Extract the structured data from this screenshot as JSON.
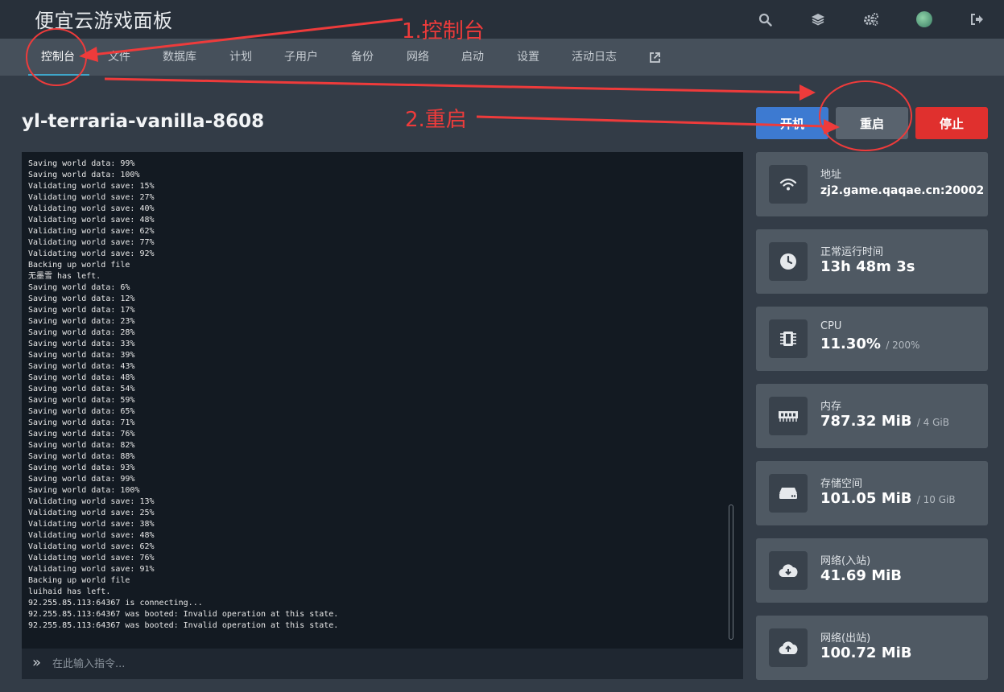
{
  "app": {
    "title": "便宜云游戏面板"
  },
  "top_icons": [
    "search-icon",
    "layers-icon",
    "gear-icon",
    "avatar",
    "logout-icon"
  ],
  "tabs": [
    {
      "label": "控制台",
      "active": true
    },
    {
      "label": "文件"
    },
    {
      "label": "数据库"
    },
    {
      "label": "计划"
    },
    {
      "label": "子用户"
    },
    {
      "label": "备份"
    },
    {
      "label": "网络"
    },
    {
      "label": "启动"
    },
    {
      "label": "设置"
    },
    {
      "label": "活动日志"
    }
  ],
  "server": {
    "name": "yl-terraria-vanilla-8608"
  },
  "power": {
    "start": "开机",
    "restart": "重启",
    "stop": "停止"
  },
  "console": {
    "lines": [
      "Saving world data: 99%",
      "Saving world data: 100%",
      "Validating world save: 15%",
      "Validating world save: 27%",
      "Validating world save: 40%",
      "Validating world save: 48%",
      "Validating world save: 62%",
      "Validating world save: 77%",
      "Validating world save: 92%",
      "Backing up world file",
      "无墨雪 has left.",
      "Saving world data: 6%",
      "Saving world data: 12%",
      "Saving world data: 17%",
      "Saving world data: 23%",
      "Saving world data: 28%",
      "Saving world data: 33%",
      "Saving world data: 39%",
      "Saving world data: 43%",
      "Saving world data: 48%",
      "Saving world data: 54%",
      "Saving world data: 59%",
      "Saving world data: 65%",
      "Saving world data: 71%",
      "Saving world data: 76%",
      "Saving world data: 82%",
      "Saving world data: 88%",
      "Saving world data: 93%",
      "Saving world data: 99%",
      "Saving world data: 100%",
      "Validating world save: 13%",
      "Validating world save: 25%",
      "Validating world save: 38%",
      "Validating world save: 48%",
      "Validating world save: 62%",
      "Validating world save: 76%",
      "Validating world save: 91%",
      "Backing up world file",
      "luihaid has left.",
      "92.255.85.113:64367 is connecting...",
      "92.255.85.113:64367 was booted: Invalid operation at this state.",
      "92.255.85.113:64367 was booted: Invalid operation at this state."
    ],
    "prompt": "»",
    "placeholder": "在此输入指令..."
  },
  "stats": {
    "address": {
      "label": "地址",
      "value": "zj2.game.qaqae.cn:20002",
      "icon": "wifi-icon"
    },
    "uptime": {
      "label": "正常运行时间",
      "value": "13h 48m 3s",
      "icon": "clock-icon"
    },
    "cpu": {
      "label": "CPU",
      "value": "11.30%",
      "limit": "/ 200%",
      "icon": "cpu-icon"
    },
    "memory": {
      "label": "内存",
      "value": "787.32 MiB",
      "limit": "/ 4 GiB",
      "icon": "memory-icon"
    },
    "disk": {
      "label": "存储空间",
      "value": "101.05 MiB",
      "limit": "/ 10 GiB",
      "icon": "hdd-icon"
    },
    "net_in": {
      "label": "网络(入站)",
      "value": "41.69 MiB",
      "icon": "cloud-download-icon"
    },
    "net_out": {
      "label": "网络(出站)",
      "value": "100.72 MiB",
      "icon": "cloud-upload-icon"
    }
  },
  "annotations": {
    "step1": "1.控制台",
    "step2": "2.重启",
    "color": "#ee3b3b"
  }
}
